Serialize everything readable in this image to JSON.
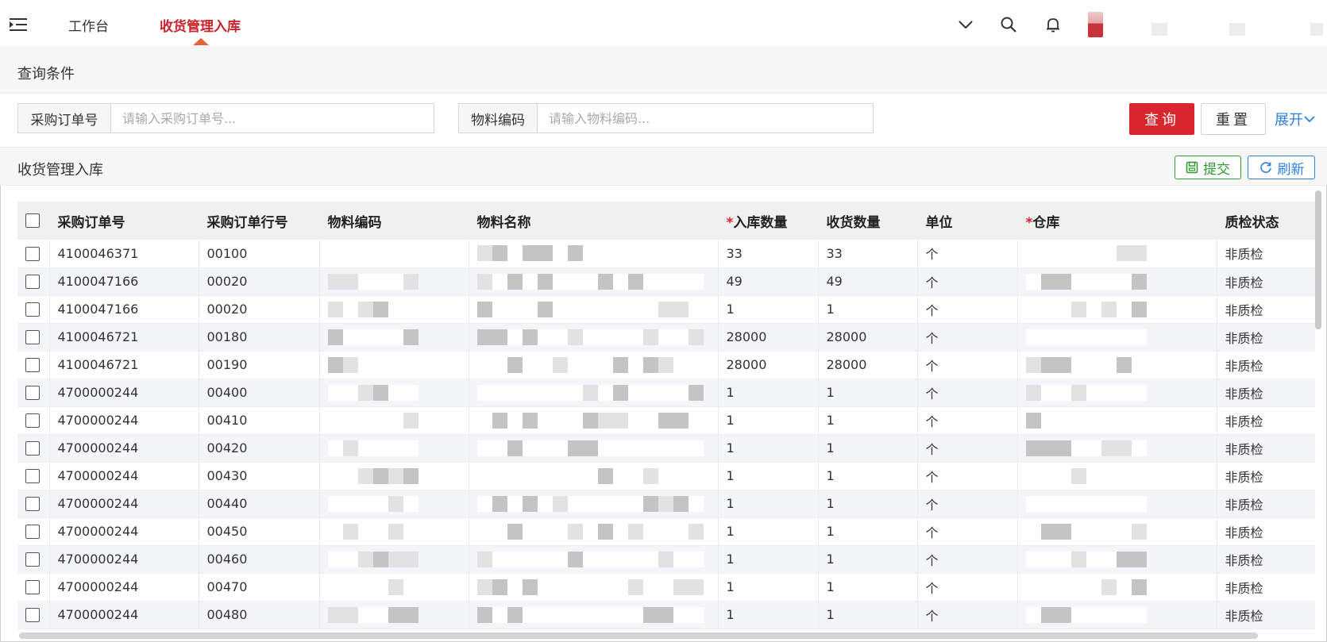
{
  "nav": {
    "tabs": [
      {
        "label": "工作台",
        "active": false
      },
      {
        "label": "收货管理入库",
        "active": true
      }
    ],
    "accent": "#c9242b"
  },
  "query": {
    "title": "查询条件",
    "po_label": "采购订单号",
    "po_placeholder": "请输入采购订单号...",
    "material_label": "物料编码",
    "material_placeholder": "请输入物料编码...",
    "query_button": "查询",
    "reset_button": "重置",
    "expand_button": "展开"
  },
  "grid": {
    "title": "收货管理入库",
    "submit_button": "提交",
    "refresh_button": "刷新",
    "columns": {
      "po": "采购订单号",
      "line": "采购订单行号",
      "material_code": "物料编码",
      "material_name": "物料名称",
      "in_qty": "入库数量",
      "recv_qty": "收货数量",
      "unit": "单位",
      "warehouse": "仓库",
      "qc": "质检状态"
    },
    "rows": [
      {
        "po": "4100046371",
        "line": "00100",
        "in_qty": "33",
        "recv_qty": "33",
        "unit": "个",
        "qc": "非质检"
      },
      {
        "po": "4100047166",
        "line": "00020",
        "in_qty": "49",
        "recv_qty": "49",
        "unit": "个",
        "qc": "非质检"
      },
      {
        "po": "4100047166",
        "line": "00020",
        "in_qty": "1",
        "recv_qty": "1",
        "unit": "个",
        "qc": "非质检"
      },
      {
        "po": "4100046721",
        "line": "00180",
        "in_qty": "28000",
        "recv_qty": "28000",
        "unit": "个",
        "qc": "非质检"
      },
      {
        "po": "4100046721",
        "line": "00190",
        "in_qty": "28000",
        "recv_qty": "28000",
        "unit": "个",
        "qc": "非质检"
      },
      {
        "po": "4700000244",
        "line": "00400",
        "in_qty": "1",
        "recv_qty": "1",
        "unit": "个",
        "qc": "非质检"
      },
      {
        "po": "4700000244",
        "line": "00410",
        "in_qty": "1",
        "recv_qty": "1",
        "unit": "个",
        "qc": "非质检"
      },
      {
        "po": "4700000244",
        "line": "00420",
        "in_qty": "1",
        "recv_qty": "1",
        "unit": "个",
        "qc": "非质检"
      },
      {
        "po": "4700000244",
        "line": "00430",
        "in_qty": "1",
        "recv_qty": "1",
        "unit": "个",
        "qc": "非质检"
      },
      {
        "po": "4700000244",
        "line": "00440",
        "in_qty": "1",
        "recv_qty": "1",
        "unit": "个",
        "qc": "非质检"
      },
      {
        "po": "4700000244",
        "line": "00450",
        "in_qty": "1",
        "recv_qty": "1",
        "unit": "个",
        "qc": "非质检"
      },
      {
        "po": "4700000244",
        "line": "00460",
        "in_qty": "1",
        "recv_qty": "1",
        "unit": "个",
        "qc": "非质检"
      },
      {
        "po": "4700000244",
        "line": "00470",
        "in_qty": "1",
        "recv_qty": "1",
        "unit": "个",
        "qc": "非质检"
      },
      {
        "po": "4700000244",
        "line": "00480",
        "in_qty": "1",
        "recv_qty": "1",
        "unit": "个",
        "qc": "非质检"
      }
    ]
  },
  "colors": {
    "primary_red": "#d9252d",
    "link_blue": "#2f7fdc",
    "submit_green": "#2e9a2e"
  },
  "icons": [
    "menu-icon",
    "chevron-down-icon",
    "search-icon",
    "bell-icon",
    "save-icon",
    "refresh-icon",
    "chevron-down-icon"
  ]
}
